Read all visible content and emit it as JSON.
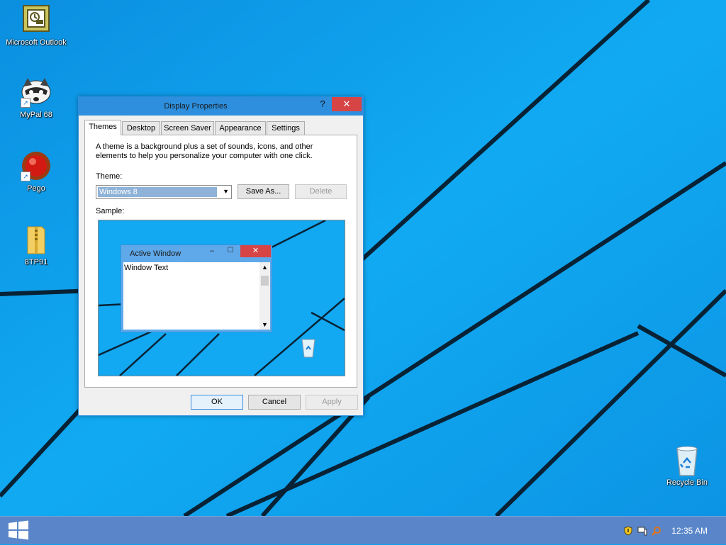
{
  "desktop": {
    "icons": [
      {
        "label": "Microsoft Outlook",
        "icon": "outlook-icon"
      },
      {
        "label": "MyPal 68",
        "icon": "raccoon-browser-icon"
      },
      {
        "label": "Pego",
        "icon": "red-button-icon"
      },
      {
        "label": "8TP91",
        "icon": "zip-folder-icon"
      },
      {
        "label": "Recycle Bin",
        "icon": "recycle-bin-icon"
      }
    ]
  },
  "taskbar": {
    "start_icon": "windows-logo-icon",
    "tray_icons": [
      "shield-icon",
      "network-icon",
      "search-icon"
    ],
    "clock": "12:35 AM"
  },
  "dialog": {
    "title": "Display Properties",
    "help": "?",
    "close": "✕",
    "tabs": [
      {
        "label": "Themes",
        "active": true
      },
      {
        "label": "Desktop",
        "active": false
      },
      {
        "label": "Screen Saver",
        "active": false
      },
      {
        "label": "Appearance",
        "active": false
      },
      {
        "label": "Settings",
        "active": false
      }
    ],
    "description": "A theme is a background plus a set of sounds, icons, and other elements to help you personalize your computer with one click.",
    "theme_label": "Theme:",
    "theme_value": "Windows 8",
    "save_as": "Save As...",
    "delete": "Delete",
    "sample_label": "Sample:",
    "sample": {
      "window_title": "Active Window",
      "minimize": "–",
      "maximize": "☐",
      "close": "✕",
      "window_text": "Window Text"
    },
    "ok": "OK",
    "cancel": "Cancel",
    "apply": "Apply"
  },
  "colors": {
    "wallpaper": "#0aa2f0",
    "taskbar": "#5a86c9",
    "title_accent": "#2d8fde",
    "close_red": "#d74446"
  }
}
